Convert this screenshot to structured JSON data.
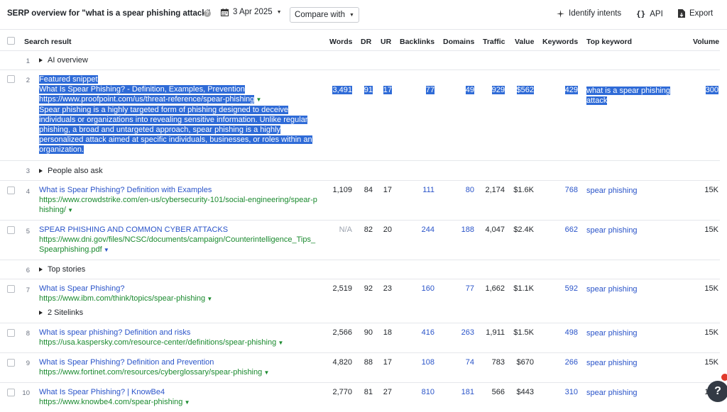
{
  "header": {
    "title": "SERP overview for \"what is a spear phishing attack\"",
    "date": "3 Apr 2025",
    "compare_label": "Compare with",
    "identify_label": "Identify intents",
    "api_label": "API",
    "export_label": "Export"
  },
  "columns": {
    "result": "Search result",
    "words": "Words",
    "dr": "DR",
    "ur": "UR",
    "backlinks": "Backlinks",
    "domains": "Domains",
    "traffic": "Traffic",
    "value": "Value",
    "keywords": "Keywords",
    "top_keyword": "Top keyword",
    "volume": "Volume"
  },
  "rows": {
    "r1": {
      "idx": "1",
      "label": "AI overview"
    },
    "r2": {
      "idx": "2",
      "tag": "Featured snippet",
      "title": "What Is Spear Phishing? - Definition, Examples, Prevention",
      "url": "https://www.proofpoint.com/us/threat-reference/spear-phishing",
      "desc1": "Spear phishing is a highly targeted form of phishing designed to deceive",
      "desc2": "individuals or organizations into revealing sensitive information. Unlike regular",
      "desc3": "phishing, a broad and untargeted approach, spear phishing is a highly",
      "desc4": "personalized attack aimed at specific individuals, businesses, or roles within an",
      "desc5": "organization.",
      "words": "3,491",
      "dr": "91",
      "ur": "17",
      "backlinks": "77",
      "domains": "49",
      "traffic": "929",
      "value": "$562",
      "keywords": "429",
      "kw1": "what is a spear phishing",
      "kw2": "attack",
      "volume": "300"
    },
    "r3": {
      "idx": "3",
      "label": "People also ask"
    },
    "r4": {
      "idx": "4",
      "title": "What is Spear Phishing? Definition with Examples",
      "url1": "https://www.crowdstrike.com/en-us/cybersecurity-101/social-engineering/spear-p",
      "url2": "hishing/",
      "words": "1,109",
      "dr": "84",
      "ur": "17",
      "backlinks": "111",
      "domains": "80",
      "traffic": "2,174",
      "value": "$1.6K",
      "keywords": "768",
      "kw": "spear phishing",
      "volume": "15K"
    },
    "r5": {
      "idx": "5",
      "title": "SPEAR PHISHING AND COMMON CYBER ATTACKS",
      "url1": "https://www.dni.gov/files/NCSC/documents/campaign/Counterintelligence_Tips_",
      "url2": "Spearphishing.pdf",
      "words": "N/A",
      "dr": "82",
      "ur": "20",
      "backlinks": "244",
      "domains": "188",
      "traffic": "4,047",
      "value": "$2.4K",
      "keywords": "662",
      "kw": "spear phishing",
      "volume": "15K"
    },
    "r6": {
      "idx": "6",
      "label": "Top stories"
    },
    "r7": {
      "idx": "7",
      "title": "What is Spear Phishing?",
      "url": "https://www.ibm.com/think/topics/spear-phishing",
      "sitelinks": "2 Sitelinks",
      "words": "2,519",
      "dr": "92",
      "ur": "23",
      "backlinks": "160",
      "domains": "77",
      "traffic": "1,662",
      "value": "$1.1K",
      "keywords": "592",
      "kw": "spear phishing",
      "volume": "15K"
    },
    "r8": {
      "idx": "8",
      "title": "What is spear phishing? Definition and risks",
      "url": "https://usa.kaspersky.com/resource-center/definitions/spear-phishing",
      "words": "2,566",
      "dr": "90",
      "ur": "18",
      "backlinks": "416",
      "domains": "263",
      "traffic": "1,911",
      "value": "$1.5K",
      "keywords": "498",
      "kw": "spear phishing",
      "volume": "15K"
    },
    "r9": {
      "idx": "9",
      "title": "What is Spear Phishing? Definition and Prevention",
      "url": "https://www.fortinet.com/resources/cyberglossary/spear-phishing",
      "words": "4,820",
      "dr": "88",
      "ur": "17",
      "backlinks": "108",
      "domains": "74",
      "traffic": "783",
      "value": "$670",
      "keywords": "266",
      "kw": "spear phishing",
      "volume": "15K"
    },
    "r10": {
      "idx": "10",
      "title": "What Is Spear Phishing? | KnowBe4",
      "url": "https://www.knowbe4.com/spear-phishing",
      "words": "2,770",
      "dr": "81",
      "ur": "27",
      "backlinks": "810",
      "domains": "181",
      "traffic": "566",
      "value": "$443",
      "keywords": "310",
      "kw": "spear phishing",
      "volume": "15K"
    }
  },
  "icons": {
    "help": "question-circle-icon",
    "calendar": "calendar-icon",
    "identify": "sparkle-icon",
    "api": "braces-icon",
    "export": "export-file-icon",
    "chat": "help-chat-icon"
  },
  "colors": {
    "link": "#2a54c9",
    "url": "#1b8a2f",
    "selection": "#2f6bd7",
    "border": "#e5e7eb"
  },
  "chat_label": "?"
}
